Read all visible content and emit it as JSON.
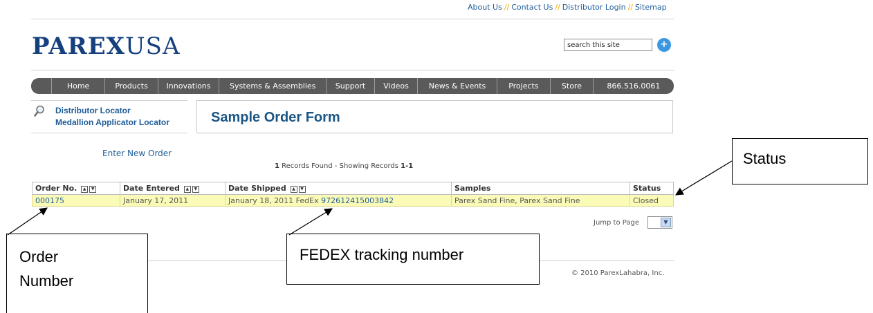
{
  "header": {
    "links": [
      "About Us",
      "Contact Us",
      "Distributor Login",
      "Sitemap"
    ],
    "separator": "//",
    "logo_bold": "PAREX",
    "logo_light": "USA",
    "search": {
      "value": "search this site",
      "button_icon": "plus-icon",
      "button_glyph": "+"
    }
  },
  "nav": {
    "items": [
      "Home",
      "Products",
      "Innovations",
      "Systems & Assemblies",
      "Support",
      "Videos",
      "News & Events",
      "Projects",
      "Store",
      "866.516.0061"
    ]
  },
  "locators": {
    "icon": "magnifier-icon",
    "distributor": "Distributor Locator",
    "medallion": "Medallion Applicator Locator"
  },
  "page_title": "Sample Order Form",
  "enter_new_order": "Enter New Order",
  "records": {
    "count": "1",
    "found_text": "Records Found - Showing Records",
    "range": "1-1"
  },
  "table": {
    "columns": [
      "Order No.",
      "Date Entered",
      "Date Shipped",
      "Samples",
      "Status"
    ],
    "sort_icons": [
      "sort-up-icon",
      "sort-down-icon"
    ],
    "rows": [
      {
        "order_no": "000175",
        "date_entered": "January 17, 2011",
        "date_shipped_text": "January 18, 2011 FedEx",
        "tracking": "972612415003842",
        "samples": "Parex Sand Fine, Parex Sand Fine",
        "status": "Closed"
      }
    ]
  },
  "pagination": {
    "label": "Jump to Page",
    "selected": ""
  },
  "footer": {
    "copyright": "© 2010 ParexLahabra, Inc."
  },
  "callouts": {
    "status": "Status",
    "order_line1": "Order",
    "order_line2": "Number",
    "fedex": "FEDEX tracking number"
  },
  "colors": {
    "brand_blue": "#15407e",
    "link_blue": "#1f5c99",
    "nav_gray": "#5a5a5a",
    "row_highlight": "#fbfbb8",
    "separator_orange": "#f0a800"
  }
}
